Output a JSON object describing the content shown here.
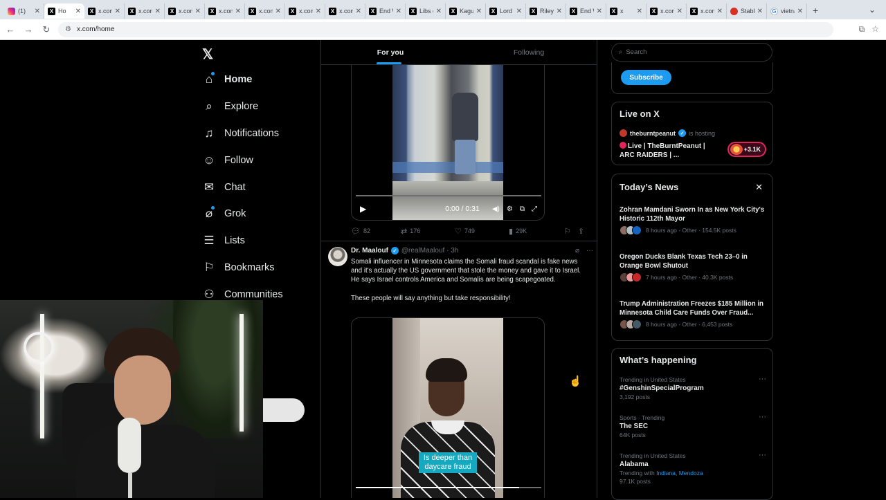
{
  "browser": {
    "tabs": [
      {
        "favicon": "instagram-icon",
        "title": "(1)"
      },
      {
        "favicon": "x-icon",
        "title": "Ho",
        "active": true
      },
      {
        "favicon": "x-icon",
        "title": "x.com/"
      },
      {
        "favicon": "x-icon",
        "title": "x.com/"
      },
      {
        "favicon": "x-icon",
        "title": "x.com/"
      },
      {
        "favicon": "x-icon",
        "title": "x.com/"
      },
      {
        "favicon": "x-icon",
        "title": "x.com/"
      },
      {
        "favicon": "x-icon",
        "title": "x.com/"
      },
      {
        "favicon": "x-icon",
        "title": "x.com/"
      },
      {
        "favicon": "x-icon",
        "title": "End Wo"
      },
      {
        "favicon": "x-icon",
        "title": "Libs of"
      },
      {
        "favicon": "x-icon",
        "title": "Kaguya"
      },
      {
        "favicon": "x-icon",
        "title": "Lord Be"
      },
      {
        "favicon": "x-icon",
        "title": "Riley G"
      },
      {
        "favicon": "x-icon",
        "title": "End Wo"
      },
      {
        "favicon": "x-icon",
        "title": "x"
      },
      {
        "favicon": "x-icon",
        "title": "x.com/"
      },
      {
        "favicon": "x-icon",
        "title": "x.com/"
      },
      {
        "favicon": "reddit-icon",
        "title": "Stable"
      },
      {
        "favicon": "google-icon",
        "title": "vietnam"
      }
    ],
    "url": "x.com/home"
  },
  "sidebar": {
    "logo": "𝕏",
    "items": [
      {
        "label": "Home",
        "icon": "home-icon",
        "glyph": "⌂",
        "dot": true
      },
      {
        "label": "Explore",
        "icon": "search-icon",
        "glyph": "⌕"
      },
      {
        "label": "Notifications",
        "icon": "bell-icon",
        "glyph": "♫"
      },
      {
        "label": "Follow",
        "icon": "follow-icon",
        "glyph": "☺"
      },
      {
        "label": "Chat",
        "icon": "mail-icon",
        "glyph": "✉"
      },
      {
        "label": "Grok",
        "icon": "grok-icon",
        "glyph": "⌀",
        "dot": true
      },
      {
        "label": "Lists",
        "icon": "list-icon",
        "glyph": "☰"
      },
      {
        "label": "Bookmarks",
        "icon": "bookmark-icon",
        "glyph": "⚐"
      },
      {
        "label": "Communities",
        "icon": "communities-icon",
        "glyph": "⚇"
      }
    ]
  },
  "feed": {
    "tabs": [
      "For you",
      "Following"
    ],
    "video1": {
      "time": "0:00 / 0:31"
    },
    "actions1": {
      "replies": "82",
      "reposts": "176",
      "likes": "749",
      "views": "29K"
    },
    "tweet2": {
      "name": "Dr. Maalouf",
      "handle": "@realMaalouf · 3h",
      "text1": "Somali influencer in Minnesota claims the Somali fraud scandal is fake news and it's actually the US government that stole the money and gave it to Israel. He says Israel controls America and Somalis are being scapegoated.",
      "text2": "These people will say anything but take responsibility!",
      "caption": "Is deeper than daycare fraud"
    }
  },
  "right": {
    "search_placeholder": "Search",
    "subscribe_label": "Subscribe",
    "live": {
      "title": "Live on X",
      "host": "theburntpeanut",
      "host_tag": "is hosting",
      "stream_title": "Live | TheBurntPeanut | ARC RAIDERS | ...",
      "count": "+3.1K"
    },
    "news": {
      "title": "Today’s News",
      "items": [
        {
          "headline": "Zohran Mamdani Sworn In as New York City's Historic 112th Mayor",
          "meta": "8 hours ago · Other · 154.5K posts"
        },
        {
          "headline": "Oregon Ducks Blank Texas Tech 23–0 in Orange Bowl Shutout",
          "meta": "7 hours ago · Other · 40.3K posts"
        },
        {
          "headline": "Trump Administration Freezes $185 Million in Minnesota Child Care Funds Over Fraud...",
          "meta": "8 hours ago · Other · 6,453 posts"
        }
      ]
    },
    "trends": {
      "title": "What’s happening",
      "items": [
        {
          "category": "Trending in United States",
          "name": "#GenshinSpecialProgram",
          "posts": "3,192 posts"
        },
        {
          "category": "Sports · Trending",
          "name": "The SEC",
          "posts": "64K posts"
        },
        {
          "category": "Trending in United States",
          "name": "Alabama",
          "with_label": "Trending with",
          "with_links": "Indiana, Mendoza",
          "posts": "97.1K posts"
        }
      ]
    }
  },
  "colors": {
    "accent": "#1d9bf0",
    "background": "#000000",
    "border": "#2f3336",
    "muted": "#71767b"
  }
}
